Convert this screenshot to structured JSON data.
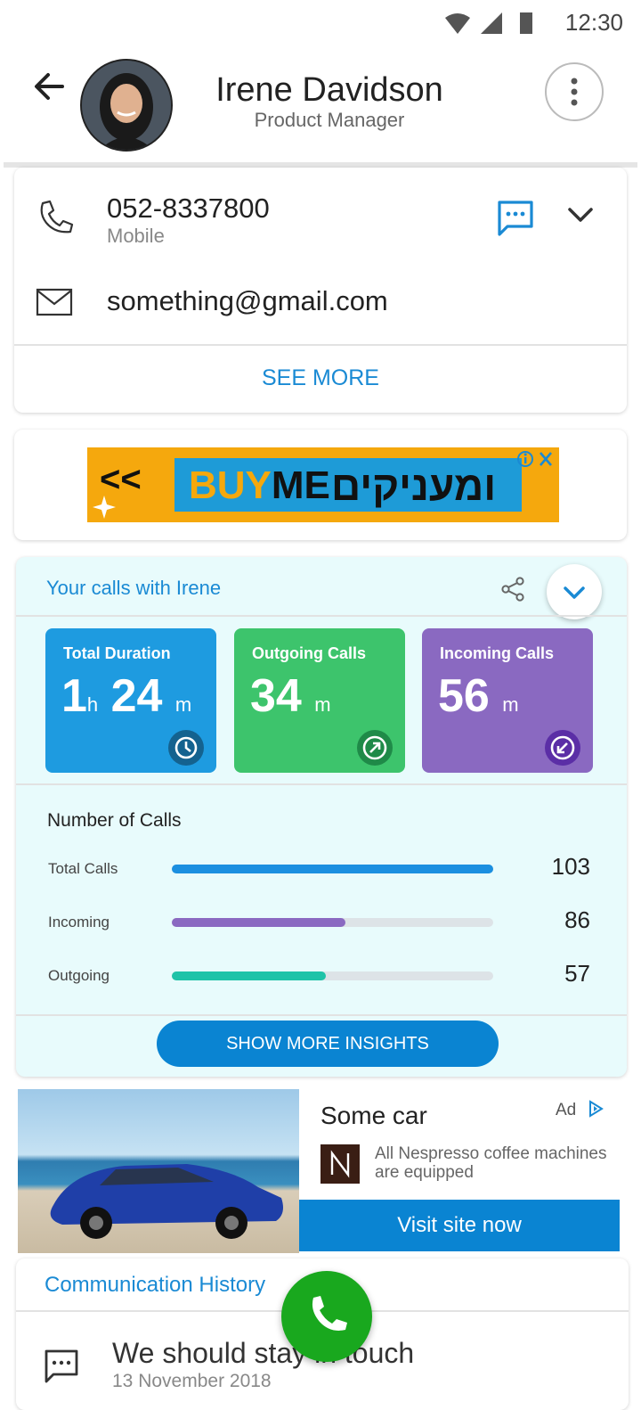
{
  "status_bar": {
    "time": "12:30"
  },
  "header": {
    "name": "Irene Davidson",
    "title": "Product Manager"
  },
  "contact": {
    "phone": "052-8337800",
    "phone_type": "Mobile",
    "email": "something@gmail.com",
    "see_more": "SEE MORE"
  },
  "banner_ad": {
    "arrows": "<<",
    "brand_buy": "BUY",
    "brand_me": "ME",
    "hebrew_text": "ומעניקים"
  },
  "calls": {
    "title": "Your calls with Irene",
    "tiles": [
      {
        "label": "Total Duration",
        "hours": "1",
        "hours_unit": "h",
        "minutes": "24",
        "minutes_unit": "m",
        "color": "#1e9be0"
      },
      {
        "label": "Outgoing Calls",
        "minutes": "34",
        "minutes_unit": "m",
        "color": "#3dc46c"
      },
      {
        "label": "Incoming Calls",
        "minutes": "56",
        "minutes_unit": "m",
        "color": "#8a69c1"
      }
    ],
    "number_of_calls_title": "Number of Calls",
    "bars": [
      {
        "label": "Total Calls",
        "value": "103",
        "fraction": 1.0,
        "color": "#1b8fe0"
      },
      {
        "label": "Incoming",
        "value": "86",
        "fraction": 0.54,
        "color": "#8a69c1"
      },
      {
        "label": "Outgoing",
        "value": "57",
        "fraction": 0.48,
        "color": "#1fc3a8"
      }
    ],
    "show_more": "SHOW MORE INSIGHTS"
  },
  "car_ad": {
    "title": "Some car",
    "badge": "Ad",
    "description": "All Nespresso coffee machines are equipped",
    "cta": "Visit site now"
  },
  "history": {
    "title": "Communication History",
    "message": "We should stay in touch",
    "date": "13 November 2018"
  }
}
